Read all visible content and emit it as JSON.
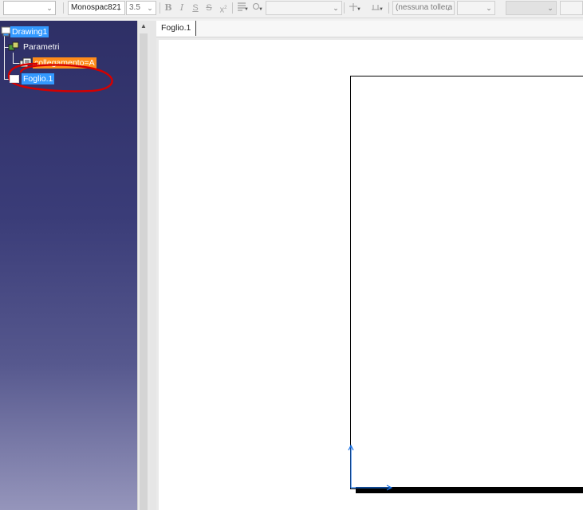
{
  "toolbar": {
    "style_combo": "",
    "font_name": "Monospac821",
    "font_size": "3.5",
    "bold": "B",
    "italic": "I",
    "underline": "S",
    "strike": "S",
    "superscript": "x",
    "tolerance_combo": "(nessuna tollera"
  },
  "tree": {
    "root": "Drawing1",
    "params": "Parametri",
    "param_item": "collegamento=A",
    "sheet": "Foglio.1"
  },
  "tabs": [
    {
      "label": "Foglio.1"
    }
  ],
  "colors": {
    "selection": "#3399ff",
    "highlight": "#ff8c1a",
    "annotation": "#d40000",
    "axis": "#1a73e8"
  }
}
